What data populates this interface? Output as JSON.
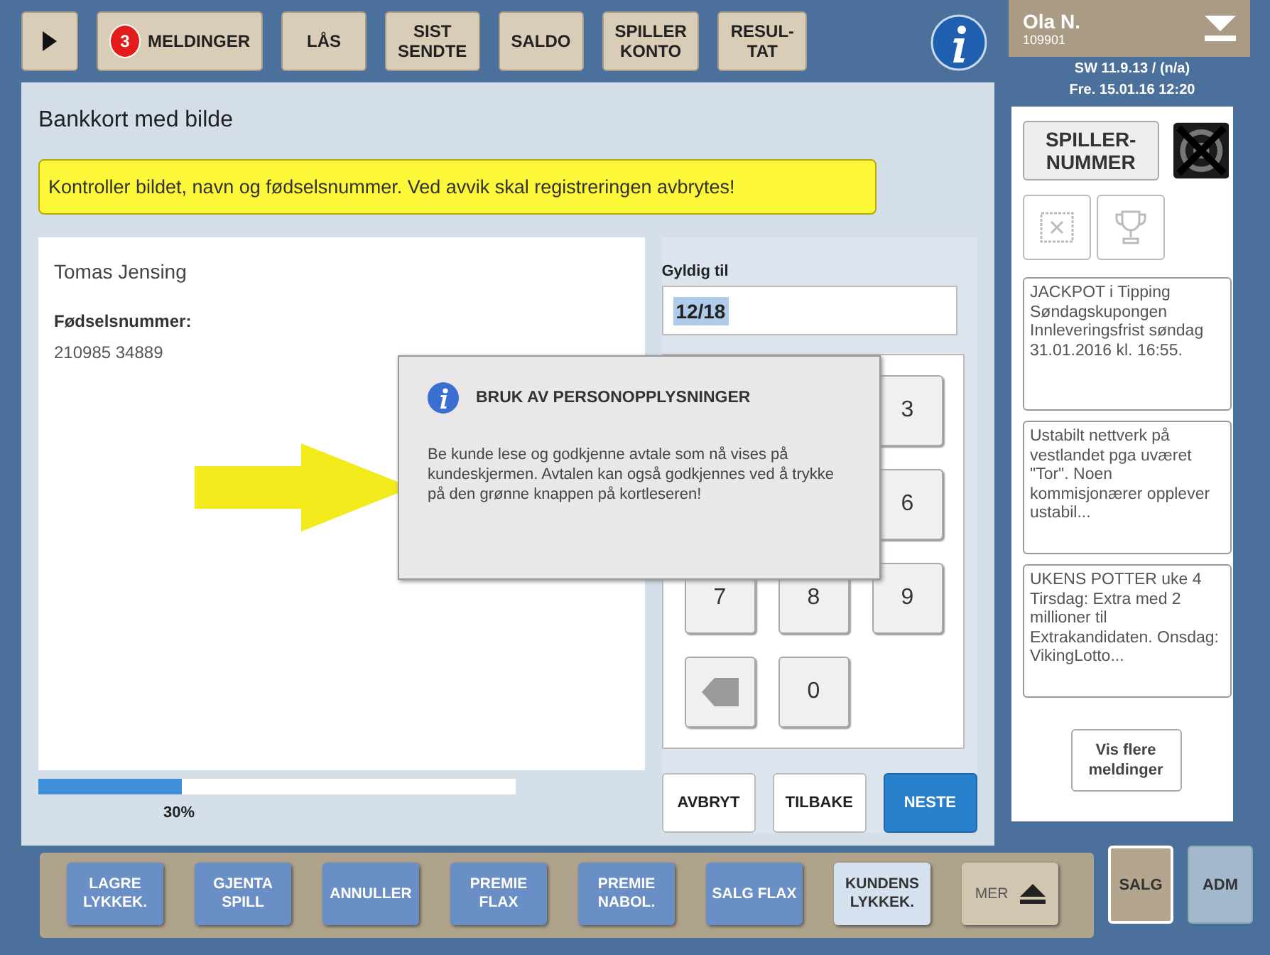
{
  "top_bar": {
    "buttons": [
      {
        "label": "MELDINGER",
        "badge": "3"
      },
      {
        "label": "LÅS"
      },
      {
        "label": "SIST\nSENDTE"
      },
      {
        "label": "SALDO"
      },
      {
        "label": "SPILLER\nKONTO"
      },
      {
        "label": "RESUL-\nTAT"
      }
    ]
  },
  "user": {
    "name": "Ola N.",
    "id": "109901"
  },
  "version": "SW 11.9.13 / (n/a)",
  "datetime": "Fre. 15.01.16 12:20",
  "page": {
    "title": "Bankkort med bilde",
    "notice": "Kontroller bildet, navn og fødselsnummer. Ved avvik skal registreringen avbrytes!",
    "holder_name": "Tomas Jensing",
    "id_label": "Fødselsnummer:",
    "id_number": "210985 34889",
    "valid_label": "Gyldig til",
    "valid_value": "12/18",
    "valid_value_selected": true,
    "keypad": [
      {
        "kind": "hidden"
      },
      {
        "kind": "hidden"
      },
      {
        "kind": "digit",
        "label": "3"
      },
      {
        "kind": "hidden"
      },
      {
        "kind": "hidden"
      },
      {
        "kind": "digit",
        "label": "6"
      },
      {
        "kind": "digit",
        "label": "7"
      },
      {
        "kind": "digit",
        "label": "8"
      },
      {
        "kind": "digit",
        "label": "9"
      },
      {
        "kind": "backspace"
      },
      {
        "kind": "digit",
        "label": "0"
      },
      {
        "kind": "empty"
      }
    ],
    "progress": {
      "level": 0.3,
      "label": "30%"
    },
    "actions": [
      {
        "label": "AVBRYT",
        "kind": "plain"
      },
      {
        "label": "TILBAKE",
        "kind": "plain"
      },
      {
        "label": "NESTE",
        "kind": "primary"
      }
    ]
  },
  "dialog": {
    "title": "BRUK AV PERSONOPPLYSNINGER",
    "body": "Be kunde lese og godkjenne avtale som nå vises på kundeskjermen. Avtalen kan også godkjennes ved å trykke på den grønne knappen på kortleseren!"
  },
  "sidebar": {
    "player_button": "SPILLER-\nNUMMER",
    "messages": [
      "JACKPOT i Tipping Søndagskupongen Innleveringsfrist søndag 31.01.2016 kl. 16:55.",
      "Ustabilt nettverk på vestlandet pga uværet \"Tor\". Noen kommisjonærer opplever ustabil...",
      "UKENS POTTER uke 4 Tirsdag: Extra med 2 millioner til Extrakandidaten. Onsdag: VikingLotto..."
    ],
    "more_button": "Vis flere\nmeldinger"
  },
  "bottom_bar": {
    "actions": [
      {
        "label": "LAGRE\nLYKKEK.",
        "kind": "game"
      },
      {
        "label": "GJENTA\nSPILL",
        "kind": "game"
      },
      {
        "label": "ANNULLER",
        "kind": "game"
      },
      {
        "label": "PREMIE\nFLAX",
        "kind": "game"
      },
      {
        "label": "PREMIE\nNABOL.",
        "kind": "game"
      },
      {
        "label": "SALG FLAX",
        "kind": "game"
      },
      {
        "label": "KUNDENS\nLYKKEK.",
        "kind": "customer"
      },
      {
        "label": "MER",
        "kind": "more"
      }
    ],
    "modes": [
      {
        "label": "SALG",
        "selected": true
      },
      {
        "label": "ADM",
        "selected": false
      }
    ]
  }
}
